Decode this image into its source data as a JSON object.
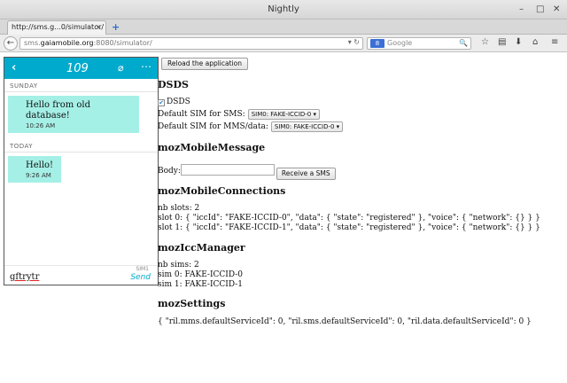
{
  "window": {
    "title": "Nightly",
    "controls": {
      "minimize": "–",
      "maximize": "□",
      "close": "✕"
    }
  },
  "tab": {
    "label": "http://sms.g...0/simulator/",
    "close": "×",
    "new_tab": "+"
  },
  "navbar": {
    "back": "←",
    "url_prefix": "sms.",
    "url_domain": "gaiamobile.org",
    "url_suffix": ":8080/simulator/",
    "url_icons": "▾ ↻",
    "search_engine": "8",
    "search_placeholder": "Google",
    "search_icon": "🔍",
    "toolbar_icons": [
      "star-icon",
      "bookmarks-icon",
      "download-icon",
      "home-icon",
      "menu-icon"
    ],
    "toolbar_glyphs": [
      "☆",
      "▤",
      "⬇",
      "⌂",
      "≡"
    ]
  },
  "phone": {
    "header": {
      "back": "‹",
      "title": "109",
      "attach": "⌀",
      "more": "⋯"
    },
    "threads": [
      {
        "day": "SUNDAY",
        "text_lines": [
          "Hello from old",
          "database!"
        ],
        "time": "10:26 AM"
      },
      {
        "day": "TODAY",
        "text_lines": [
          "Hello!"
        ],
        "time": "9:26 AM"
      }
    ],
    "compose": {
      "text": "gftrytr",
      "sim_label": "SIM1",
      "send": "Send"
    }
  },
  "content": {
    "reload_label": "Reload the application",
    "dsds": {
      "heading": "DSDS",
      "checkbox_label": "DSDS",
      "checked_glyph": "✔",
      "sms_label": "Default SIM for SMS:",
      "sms_value": "SIM0: FAKE-ICCID-0 ▾",
      "mms_label": "Default SIM for MMS/data:",
      "mms_value": "SIM0: FAKE-ICCID-0 ▾"
    },
    "mobile_message": {
      "heading": "mozMobileMessage",
      "body_label": "Body:",
      "receive_label": "Receive a SMS"
    },
    "mobile_connections": {
      "heading": "mozMobileConnections",
      "lines": [
        "nb slots: 2",
        "slot 0: { \"iccId\": \"FAKE-ICCID-0\", \"data\": { \"state\": \"registered\" }, \"voice\": { \"network\": {} } }",
        "slot 1: { \"iccId\": \"FAKE-ICCID-1\", \"data\": { \"state\": \"registered\" }, \"voice\": { \"network\": {} } }"
      ]
    },
    "icc_manager": {
      "heading": "mozIccManager",
      "lines": [
        "nb sims: 2",
        "sim 0: FAKE-ICCID-0",
        "sim 1: FAKE-ICCID-1"
      ]
    },
    "settings": {
      "heading": "mozSettings",
      "line": "{ \"ril.mms.defaultServiceId\": 0, \"ril.sms.defaultServiceId\": 0, \"ril.data.defaultServiceId\": 0 }"
    }
  }
}
